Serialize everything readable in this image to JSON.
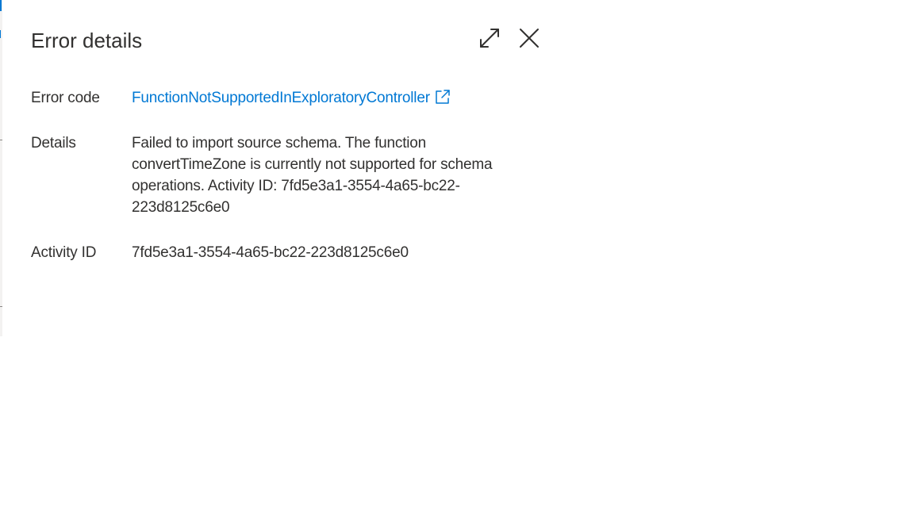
{
  "panel": {
    "title": "Error details",
    "expand_icon": "expand-icon",
    "close_icon": "close-icon"
  },
  "fields": {
    "error_code": {
      "label": "Error code",
      "value": "FunctionNotSupportedInExploratoryController",
      "icon": "external-link-icon"
    },
    "details": {
      "label": "Details",
      "value": "Failed to import source schema. The function convertTimeZone is currently not supported for schema operations. Activity ID: 7fd5e3a1-3554-4a65-bc22-223d8125c6e0"
    },
    "activity_id": {
      "label": "Activity ID",
      "value": "7fd5e3a1-3554-4a65-bc22-223d8125c6e0"
    }
  },
  "colors": {
    "link": "#0078d4",
    "text": "#323130",
    "background": "#ffffff"
  }
}
